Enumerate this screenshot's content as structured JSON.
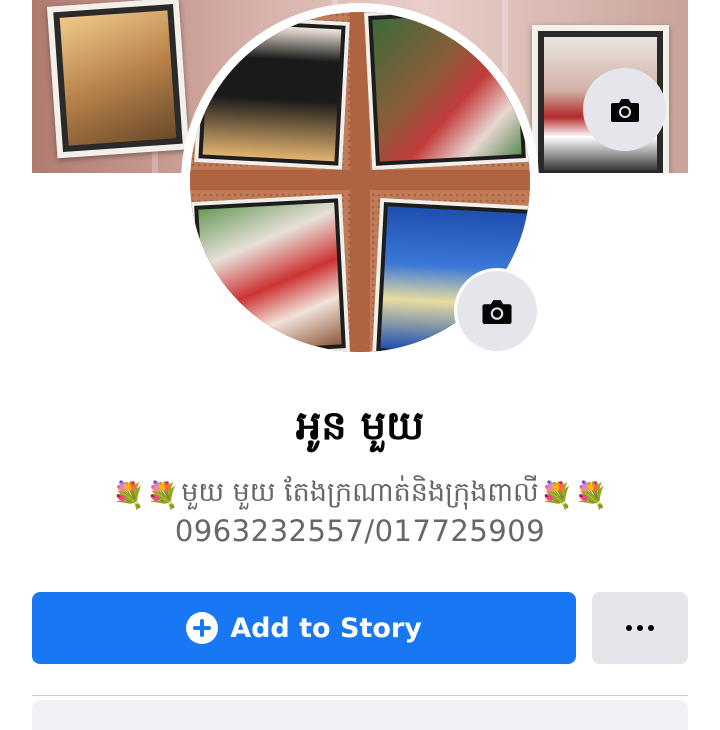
{
  "profile": {
    "name": "អូន មួយ",
    "bio_text": "មួយ មួយ តែងក្រណាត់និងក្រុងពាលី",
    "bio_line2": "0963232557/017725909",
    "bio_flower_icon": "💐"
  },
  "actions": {
    "add_story_label": "Add to Story",
    "add_story_icon": "plus-circle-icon",
    "more_icon": "more-dots-icon"
  },
  "icons": {
    "cover_camera": "camera-icon",
    "avatar_camera": "camera-icon"
  },
  "colors": {
    "primary": "#1877f2",
    "secondary_button": "#e4e6eb",
    "text_primary": "#050505",
    "text_secondary": "#65676b"
  }
}
